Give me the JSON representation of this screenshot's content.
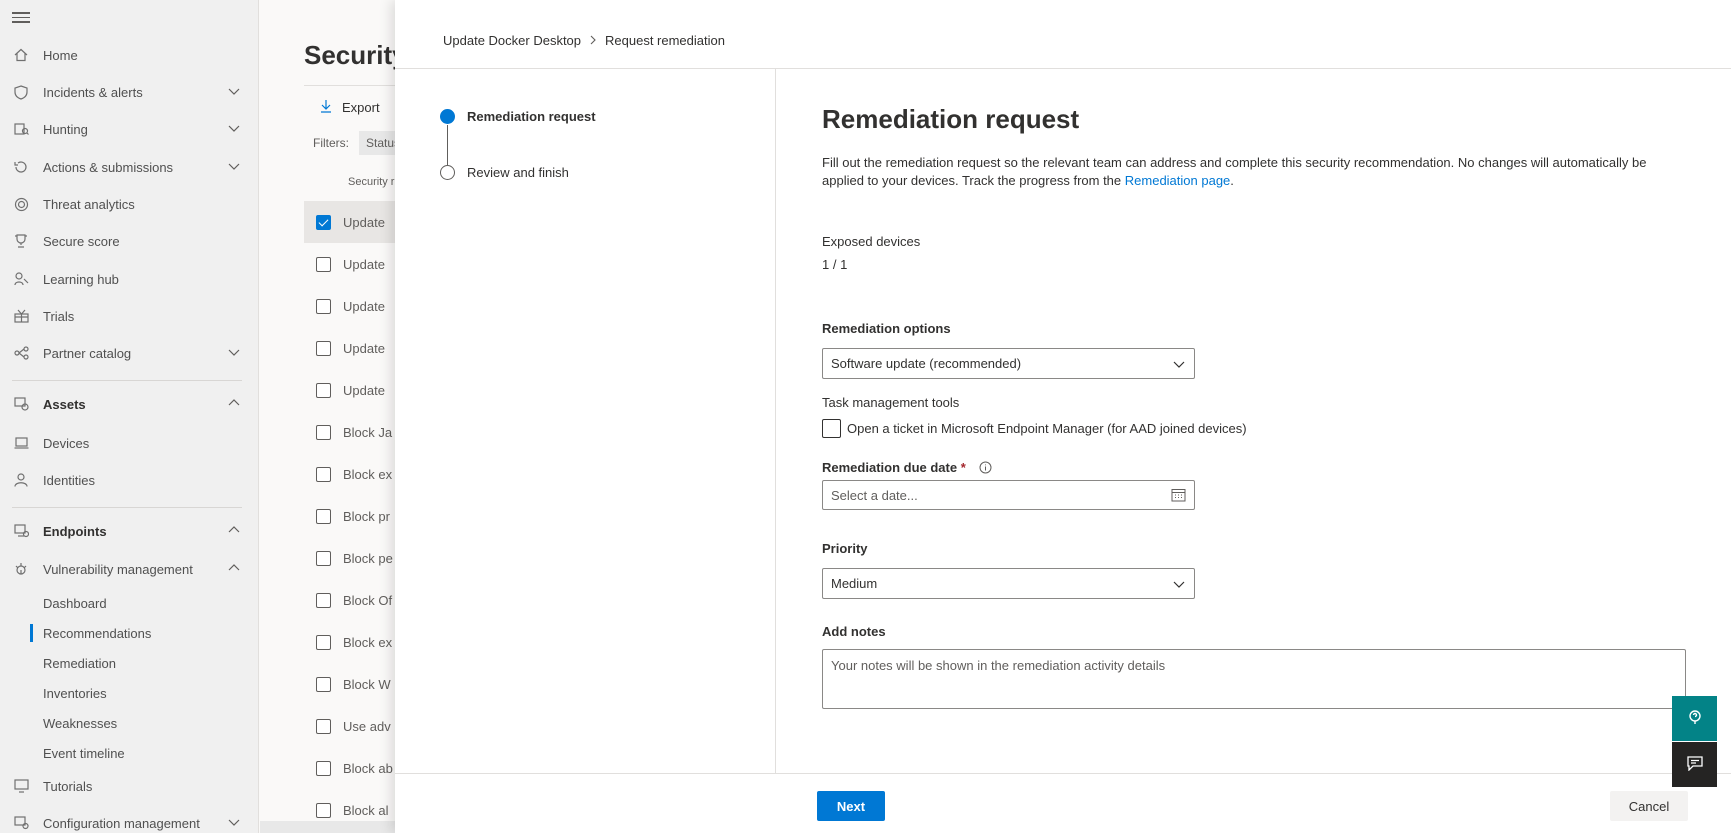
{
  "nav": {
    "items": [
      {
        "label": "Home",
        "icon": "home-icon"
      },
      {
        "label": "Incidents & alerts",
        "icon": "shield-icon"
      },
      {
        "label": "Hunting",
        "icon": "hunting-icon"
      },
      {
        "label": "Actions & submissions",
        "icon": "actions-icon"
      },
      {
        "label": "Threat analytics",
        "icon": "threat-analytics-icon"
      },
      {
        "label": "Secure score",
        "icon": "trophy-icon"
      },
      {
        "label": "Learning hub",
        "icon": "learning-hub-icon"
      },
      {
        "label": "Trials",
        "icon": "trials-icon"
      },
      {
        "label": "Partner catalog",
        "icon": "partner-icon"
      },
      {
        "label": "Assets",
        "icon": "assets-icon"
      },
      {
        "label": "Devices",
        "icon": "laptop-icon"
      },
      {
        "label": "Identities",
        "icon": "person-icon"
      },
      {
        "label": "Endpoints",
        "icon": "endpoints-icon"
      },
      {
        "label": "Vulnerability management",
        "icon": "vulnerability-icon"
      },
      {
        "label": "Tutorials",
        "icon": "tutorials-icon"
      },
      {
        "label": "Configuration management",
        "icon": "config-icon"
      }
    ],
    "sub_items": [
      "Dashboard",
      "Recommendations",
      "Remediation",
      "Inventories",
      "Weaknesses",
      "Event timeline"
    ]
  },
  "background": {
    "title": "Security",
    "export_label": "Export",
    "filters_label": "Filters:",
    "status_chip": "Status",
    "column_header": "Security r",
    "rows": [
      "Update",
      "Update",
      "Update",
      "Update",
      "Update",
      "Block Ja",
      "Block ex",
      "Block pr",
      "Block pe",
      "Block Of",
      "Block ex",
      "Block W",
      "Use adv",
      "Block ab",
      "Block al"
    ]
  },
  "panel": {
    "breadcrumb": {
      "parent": "Update Docker Desktop",
      "current": "Request remediation"
    },
    "steps": [
      {
        "label": "Remediation request",
        "state": "active"
      },
      {
        "label": "Review and finish",
        "state": "pending"
      }
    ],
    "heading": "Remediation request",
    "description_prefix": "Fill out the remediation request so the relevant team can address and complete this security recommendation. No changes will automatically be applied to your devices. Track the progress from the ",
    "description_link": "Remediation page",
    "description_suffix": ".",
    "exposed_devices_label": "Exposed devices",
    "exposed_devices_value": "1 / 1",
    "remediation_options_label": "Remediation options",
    "remediation_options_value": "Software update (recommended)",
    "task_tools_label": "Task management tools",
    "ticket_checkbox_label": "Open a ticket in Microsoft Endpoint Manager (for AAD joined devices)",
    "due_date_label": "Remediation due date",
    "required_mark": "*",
    "due_date_placeholder": "Select a date...",
    "priority_label": "Priority",
    "priority_value": "Medium",
    "notes_label": "Add notes",
    "notes_placeholder": "Your notes will be shown in the remediation activity details",
    "next_label": "Next",
    "cancel_label": "Cancel"
  },
  "colors": {
    "accent": "#0078d4",
    "teal": "#038387",
    "dark": "#252423"
  }
}
